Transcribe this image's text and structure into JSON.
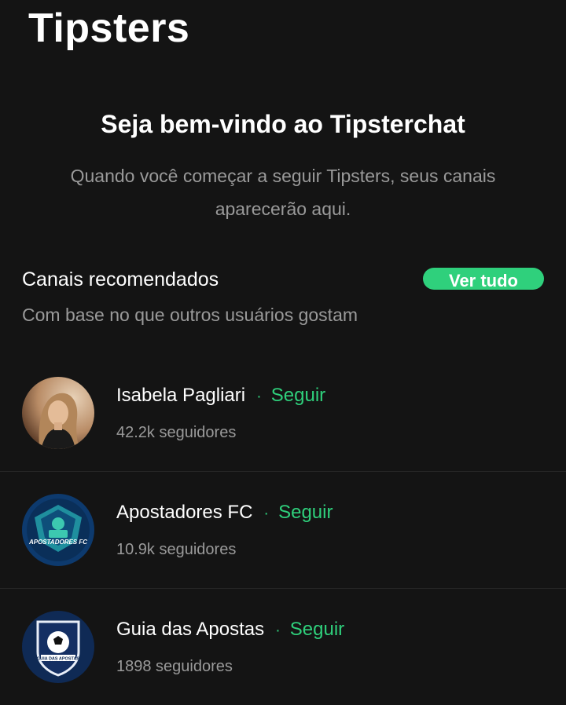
{
  "header": {
    "title": "Tipsters"
  },
  "welcome": {
    "title": "Seja bem-vindo ao Tipsterchat",
    "text": "Quando você começar a seguir Tipsters, seus canais aparecerão aqui."
  },
  "recommended": {
    "title": "Canais recomendados",
    "subtitle": "Com base no que outros usuários gostam",
    "see_all_label": "Ver tudo",
    "accent_color": "#2fd07c",
    "channels": [
      {
        "name": "Isabela Pagliari",
        "follow_label": "Seguir",
        "followers": "42.2k seguidores",
        "avatar": "woman-portrait-photo"
      },
      {
        "name": "Apostadores FC",
        "follow_label": "Seguir",
        "followers": "10.9k seguidores",
        "avatar": "apostadores-fc-logo",
        "avatar_text": "APOSTADORES FC"
      },
      {
        "name": "Guia das Apostas",
        "follow_label": "Seguir",
        "followers": "1898 seguidores",
        "avatar": "guia-das-apostas-logo",
        "avatar_text": "GUIA DAS APOSTAS"
      }
    ]
  }
}
